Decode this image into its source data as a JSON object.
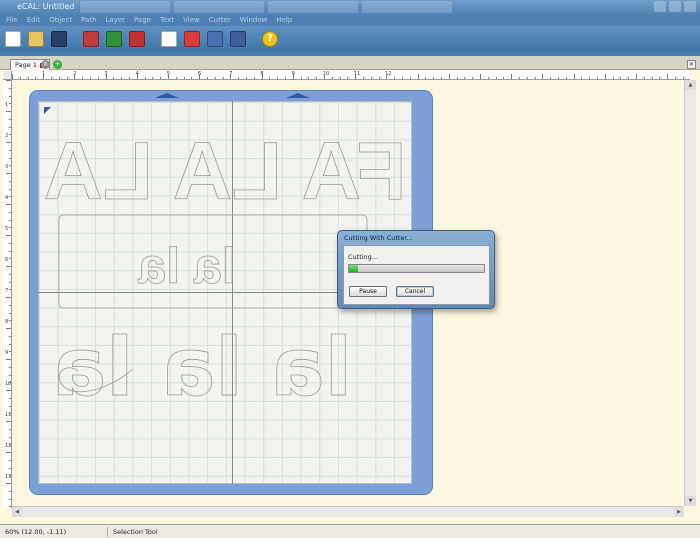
{
  "window": {
    "title": "eCAL: Untitled"
  },
  "menu": [
    "File",
    "Edit",
    "Object",
    "Path",
    "Layer",
    "Page",
    "Text",
    "View",
    "Cutter",
    "Window",
    "Help"
  ],
  "toolbar": {
    "buttons": [
      {
        "name": "new-icon",
        "color": "#ffffff"
      },
      {
        "name": "open-icon",
        "color": "#e8c466"
      },
      {
        "name": "save-icon",
        "color": "#2a3f66"
      },
      {
        "name": "import-icon",
        "color": "#c23a3a"
      },
      {
        "name": "export-icon",
        "color": "#2f8f3a"
      },
      {
        "name": "color-icon",
        "color": "#c43030"
      },
      {
        "name": "preview-icon",
        "color": "#ffffff"
      },
      {
        "name": "cut-icon",
        "color": "#d63c3c"
      },
      {
        "name": "cut-settings-icon",
        "color": "#4a6fb0"
      },
      {
        "name": "print-icon",
        "color": "#3c5e9a"
      },
      {
        "name": "help-icon",
        "color": "#f1c21b"
      }
    ]
  },
  "tabs": {
    "page_label": "Page 1"
  },
  "rulers": {
    "horizontal": [
      "1",
      "2",
      "3",
      "4",
      "5",
      "6",
      "7",
      "8",
      "9",
      "10",
      "11",
      "12"
    ],
    "vertical": [
      "1",
      "2",
      "3",
      "4",
      "5",
      "6",
      "7",
      "8",
      "9",
      "10",
      "11",
      "12",
      "13"
    ]
  },
  "artwork": {
    "row1": "FA LA LA",
    "row2": "la la",
    "row3": "la la la"
  },
  "dialog": {
    "title": "Cutting With Cutter...",
    "status": "Cutting...",
    "progress": 0.07,
    "pause_label": "Pause",
    "cancel_label": "Cancel"
  },
  "status": {
    "coords": "60% (12.00, -1.11)",
    "tool": "Selection Tool"
  }
}
